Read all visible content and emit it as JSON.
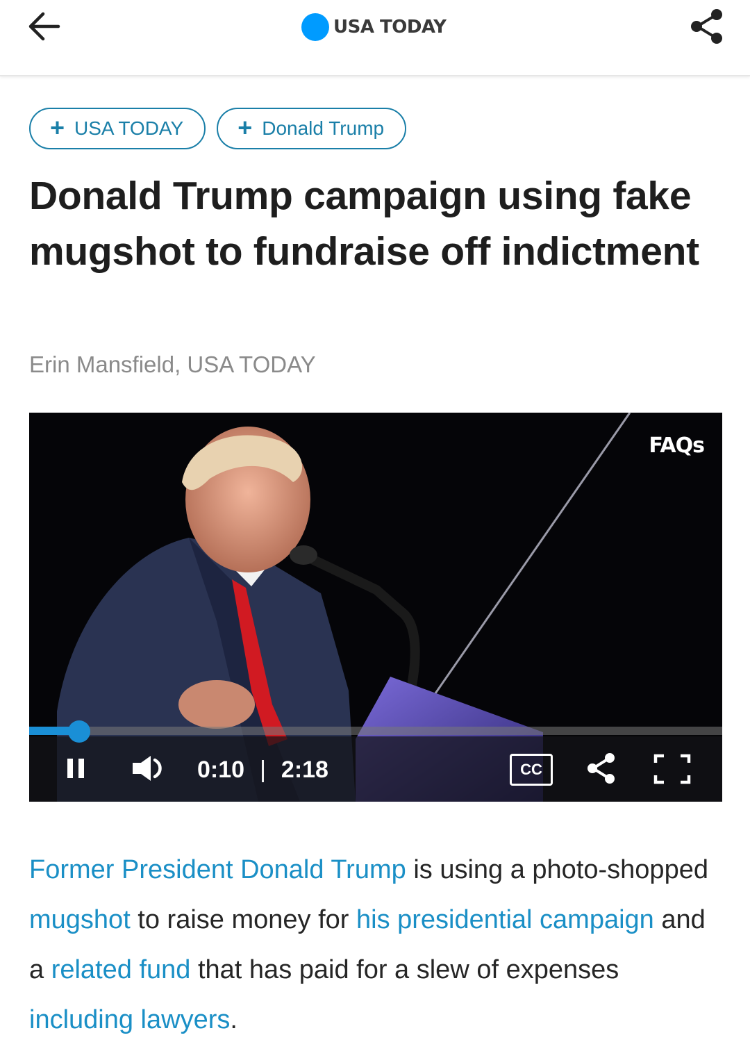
{
  "header": {
    "back_icon": "arrow-left-icon",
    "brand": "USA TODAY",
    "brand_color": "#009bff",
    "share_icon": "share-icon"
  },
  "topics": [
    {
      "label": "USA TODAY",
      "icon": "plus-icon"
    },
    {
      "label": "Donald Trump",
      "icon": "plus-icon"
    }
  ],
  "article": {
    "headline": "Donald Trump campaign using fake mugshot to fundraise off indictment",
    "byline": "Erin Mansfield, USA TODAY"
  },
  "video": {
    "overlay_label": "FAQs",
    "current_time": "0:10",
    "separator": "|",
    "duration": "2:18",
    "progress_fraction": 0.072,
    "cc_label": "CC",
    "accent_color": "#1a8fd6",
    "icons": [
      "pause-icon",
      "volume-icon",
      "cc-icon",
      "share-icon",
      "fullscreen-icon"
    ]
  },
  "body": {
    "paragraph": [
      {
        "text": "Former President Donald Trump",
        "link": true
      },
      {
        "text": " is using a photo-shopped ",
        "link": false
      },
      {
        "text": "mugshot",
        "link": true
      },
      {
        "text": " to raise money for ",
        "link": false
      },
      {
        "text": "his presidential campaign",
        "link": true
      },
      {
        "text": " and a ",
        "link": false
      },
      {
        "text": "related fund",
        "link": true
      },
      {
        "text": " that has paid for a slew of expenses ",
        "link": false
      },
      {
        "text": "including lawyers",
        "link": true
      },
      {
        "text": ".",
        "link": false
      }
    ],
    "link_color": "#1a8fc6"
  }
}
